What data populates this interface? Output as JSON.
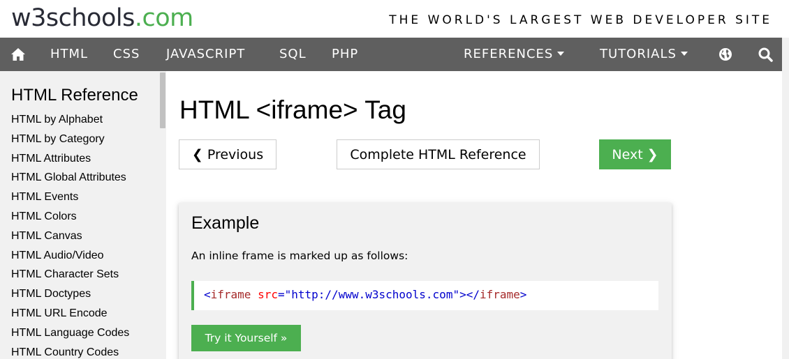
{
  "header": {
    "logo_main": "w3schools",
    "logo_suffix": ".com",
    "tagline": "THE WORLD'S LARGEST WEB DEVELOPER SITE"
  },
  "navbar": {
    "home_icon": "home-icon",
    "items": [
      "HTML",
      "CSS",
      "JAVASCRIPT",
      "SQL",
      "PHP"
    ],
    "references": "REFERENCES",
    "tutorials": "TUTORIALS",
    "globe_icon": "globe-icon",
    "search_icon": "search-icon"
  },
  "sidebar": {
    "title": "HTML Reference",
    "items": [
      "HTML by Alphabet",
      "HTML by Category",
      "HTML Attributes",
      "HTML Global Attributes",
      "HTML Events",
      "HTML Colors",
      "HTML Canvas",
      "HTML Audio/Video",
      "HTML Character Sets",
      "HTML Doctypes",
      "HTML URL Encode",
      "HTML Language Codes",
      "HTML Country Codes"
    ]
  },
  "main": {
    "title": "HTML <iframe> Tag",
    "previous_label": "❮ Previous",
    "reference_label": "Complete HTML Reference",
    "next_label": "Next ❯"
  },
  "example": {
    "title": "Example",
    "description": "An inline frame is marked up as follows:",
    "code": {
      "open_bracket": "<",
      "tag": "iframe",
      "attr": "src",
      "equals": "=",
      "value": "\"http://www.w3schools.com\"",
      "mid": "></",
      "close_tag": "iframe",
      "close_bracket": ">"
    },
    "try_label": "Try it Yourself »"
  },
  "colors": {
    "brand_green": "#4caf50",
    "navbar_gray": "#5f5f5f",
    "sidebar_bg": "#f1f1f1"
  }
}
